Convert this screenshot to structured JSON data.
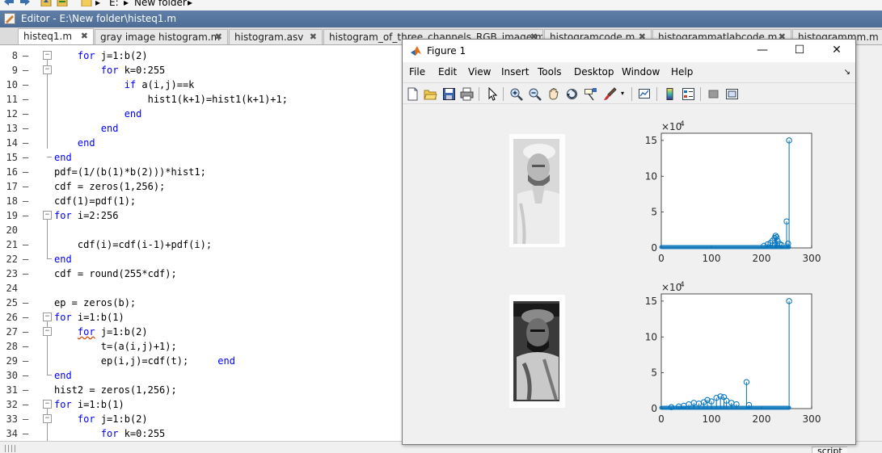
{
  "topbar": {
    "crumb_root": "E:",
    "crumb_folder": "New folder"
  },
  "editor": {
    "title": "Editor - E:\\New folder\\histeq1.m"
  },
  "tabs": [
    {
      "label": "histeq1.m",
      "close": "✖"
    },
    {
      "label": "gray image histogram.m",
      "close": "✖"
    },
    {
      "label": "histogram.asv",
      "close": "✖"
    },
    {
      "label": "histogram_of_three_channels_RGB_image.m",
      "close": "✖"
    },
    {
      "label": "histogramcode.m",
      "close": "✖"
    },
    {
      "label": "histogrammatlabcode.m",
      "close": "✖"
    },
    {
      "label": "histogrammm.m",
      "close": ""
    }
  ],
  "code_lines": [
    {
      "n": "8",
      "dash": "–",
      "pre": "    ",
      "kw": "for",
      "rest": " j=1:b(2)"
    },
    {
      "n": "9",
      "dash": "–",
      "pre": "        ",
      "kw": "for",
      "rest": " k=0:255"
    },
    {
      "n": "10",
      "dash": "–",
      "pre": "            ",
      "kw": "if",
      "rest": " a(i,j)==k"
    },
    {
      "n": "11",
      "dash": "–",
      "pre": "                ",
      "kw": "",
      "rest": "hist1(k+1)=hist1(k+1)+1;"
    },
    {
      "n": "12",
      "dash": "–",
      "pre": "            ",
      "kw": "end",
      "rest": ""
    },
    {
      "n": "13",
      "dash": "–",
      "pre": "        ",
      "kw": "end",
      "rest": ""
    },
    {
      "n": "14",
      "dash": "–",
      "pre": "    ",
      "kw": "end",
      "rest": ""
    },
    {
      "n": "15",
      "dash": "–",
      "pre": "",
      "kw": "end",
      "rest": ""
    },
    {
      "n": "16",
      "dash": "–",
      "pre": "",
      "kw": "",
      "rest": "pdf=(1/(b(1)*b(2)))*hist1;"
    },
    {
      "n": "17",
      "dash": "–",
      "pre": "",
      "kw": "",
      "rest": "cdf = zeros(1,256);"
    },
    {
      "n": "18",
      "dash": "–",
      "pre": "",
      "kw": "",
      "rest": "cdf(1)=pdf(1);"
    },
    {
      "n": "19",
      "dash": "–",
      "pre": "",
      "kw": "for",
      "rest": " i=2:256"
    },
    {
      "n": "20",
      "dash": "",
      "pre": "",
      "kw": "",
      "rest": ""
    },
    {
      "n": "21",
      "dash": "–",
      "pre": "    ",
      "kw": "",
      "rest": "cdf(i)=cdf(i-1)+pdf(i);"
    },
    {
      "n": "22",
      "dash": "–",
      "pre": "",
      "kw": "end",
      "rest": ""
    },
    {
      "n": "23",
      "dash": "–",
      "pre": "",
      "kw": "",
      "rest": "cdf = round(255*cdf);"
    },
    {
      "n": "24",
      "dash": "",
      "pre": "",
      "kw": "",
      "rest": ""
    },
    {
      "n": "25",
      "dash": "–",
      "pre": "",
      "kw": "",
      "rest": "ep = zeros(b);"
    },
    {
      "n": "26",
      "dash": "–",
      "pre": "",
      "kw": "for",
      "rest": " i=1:b(1)"
    },
    {
      "n": "27",
      "dash": "–",
      "pre": "    ",
      "kw": "for",
      "rest": " j=1:b(2)"
    },
    {
      "n": "28",
      "dash": "–",
      "pre": "        ",
      "kw": "",
      "rest": "t=(a(i,j)+1);"
    },
    {
      "n": "29",
      "dash": "–",
      "pre": "        ",
      "kw": "",
      "rest": "ep(i,j)=cdf(t);     ",
      "kw2": "end"
    },
    {
      "n": "30",
      "dash": "–",
      "pre": "",
      "kw": "end",
      "rest": ""
    },
    {
      "n": "31",
      "dash": "–",
      "pre": "",
      "kw": "",
      "rest": "hist2 = zeros(1,256);"
    },
    {
      "n": "32",
      "dash": "–",
      "pre": "",
      "kw": "for",
      "rest": " i=1:b(1)"
    },
    {
      "n": "33",
      "dash": "–",
      "pre": "    ",
      "kw": "for",
      "rest": " j=1:b(2)"
    },
    {
      "n": "34",
      "dash": "–",
      "pre": "        ",
      "kw": "for",
      "rest": " k=0:255"
    }
  ],
  "figure": {
    "title": "Figure 1",
    "win_minimize": "—",
    "win_maximize": "☐",
    "win_close": "✕",
    "menu": [
      "File",
      "Edit",
      "View",
      "Insert",
      "Tools",
      "Desktop",
      "Window",
      "Help"
    ],
    "dock_glyph": "↘",
    "toolbar_icons": [
      "new-figure-icon",
      "open-file-icon",
      "save-icon",
      "print-icon",
      "pointer-icon",
      "zoom-in-icon",
      "zoom-out-icon",
      "pan-icon",
      "rotate-icon",
      "data-cursor-icon",
      "brush-icon",
      "link-plot-icon",
      "colorbar-icon",
      "legend-icon",
      "hide-plot-tools-icon",
      "show-plot-tools-icon"
    ]
  },
  "statusbar": {
    "script_label": "script"
  },
  "chart_data": [
    {
      "type": "stem",
      "title": "",
      "exponent_label": "×10",
      "exponent": "4",
      "xlim": [
        0,
        300
      ],
      "ylim": [
        0,
        16
      ],
      "xticks": [
        "0",
        "100",
        "200",
        "300"
      ],
      "yticks": [
        "0",
        "5",
        "10",
        "15"
      ],
      "color": "#0072bd",
      "stems": [
        {
          "x": 205,
          "y": 0.3
        },
        {
          "x": 212,
          "y": 0.5
        },
        {
          "x": 218,
          "y": 0.7
        },
        {
          "x": 222,
          "y": 1.0
        },
        {
          "x": 226,
          "y": 1.4
        },
        {
          "x": 228,
          "y": 1.7
        },
        {
          "x": 230,
          "y": 1.5
        },
        {
          "x": 232,
          "y": 1.0
        },
        {
          "x": 236,
          "y": 0.6
        },
        {
          "x": 240,
          "y": 0.4
        },
        {
          "x": 250,
          "y": 3.7
        },
        {
          "x": 253,
          "y": 0.6
        },
        {
          "x": 255,
          "y": 15.0
        }
      ]
    },
    {
      "type": "stem",
      "title": "",
      "exponent_label": "×10",
      "exponent": "4",
      "xlim": [
        0,
        300
      ],
      "ylim": [
        0,
        16
      ],
      "xticks": [
        "0",
        "100",
        "200",
        "300"
      ],
      "yticks": [
        "0",
        "5",
        "10",
        "15"
      ],
      "color": "#0072bd",
      "stems": [
        {
          "x": 20,
          "y": 0.2
        },
        {
          "x": 35,
          "y": 0.3
        },
        {
          "x": 45,
          "y": 0.4
        },
        {
          "x": 55,
          "y": 0.6
        },
        {
          "x": 65,
          "y": 0.8
        },
        {
          "x": 75,
          "y": 0.7
        },
        {
          "x": 85,
          "y": 0.9
        },
        {
          "x": 92,
          "y": 1.2
        },
        {
          "x": 100,
          "y": 1.0
        },
        {
          "x": 110,
          "y": 1.5
        },
        {
          "x": 118,
          "y": 1.7
        },
        {
          "x": 125,
          "y": 1.6
        },
        {
          "x": 130,
          "y": 1.1
        },
        {
          "x": 140,
          "y": 0.8
        },
        {
          "x": 150,
          "y": 0.6
        },
        {
          "x": 170,
          "y": 3.7
        },
        {
          "x": 175,
          "y": 0.5
        },
        {
          "x": 255,
          "y": 15.0
        }
      ]
    }
  ]
}
